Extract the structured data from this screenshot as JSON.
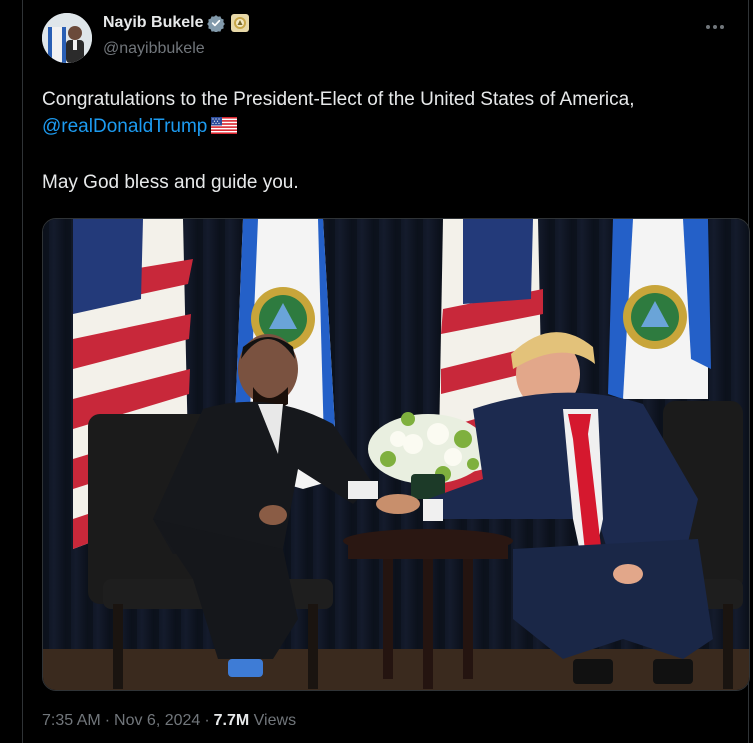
{
  "author": {
    "display_name": "Nayib Bukele",
    "handle": "@nayibbukele",
    "badge_color": "#829aab",
    "gov_badge_icon": "el-salvador-seal-icon"
  },
  "tweet": {
    "line1": "Congratulations to the President-Elect of the United States of America,",
    "mention": "@realDonaldTrump",
    "line3": "May God bless and guide you."
  },
  "meta": {
    "time": "7:35 AM",
    "separator": "·",
    "date": "Nov 6, 2024",
    "views_count": "7.7M",
    "views_label": "Views"
  },
  "colors": {
    "background": "#000000",
    "text": "#e7e9ea",
    "secondary": "#71767b",
    "link": "#1d9bf0",
    "border": "#2f3336"
  }
}
